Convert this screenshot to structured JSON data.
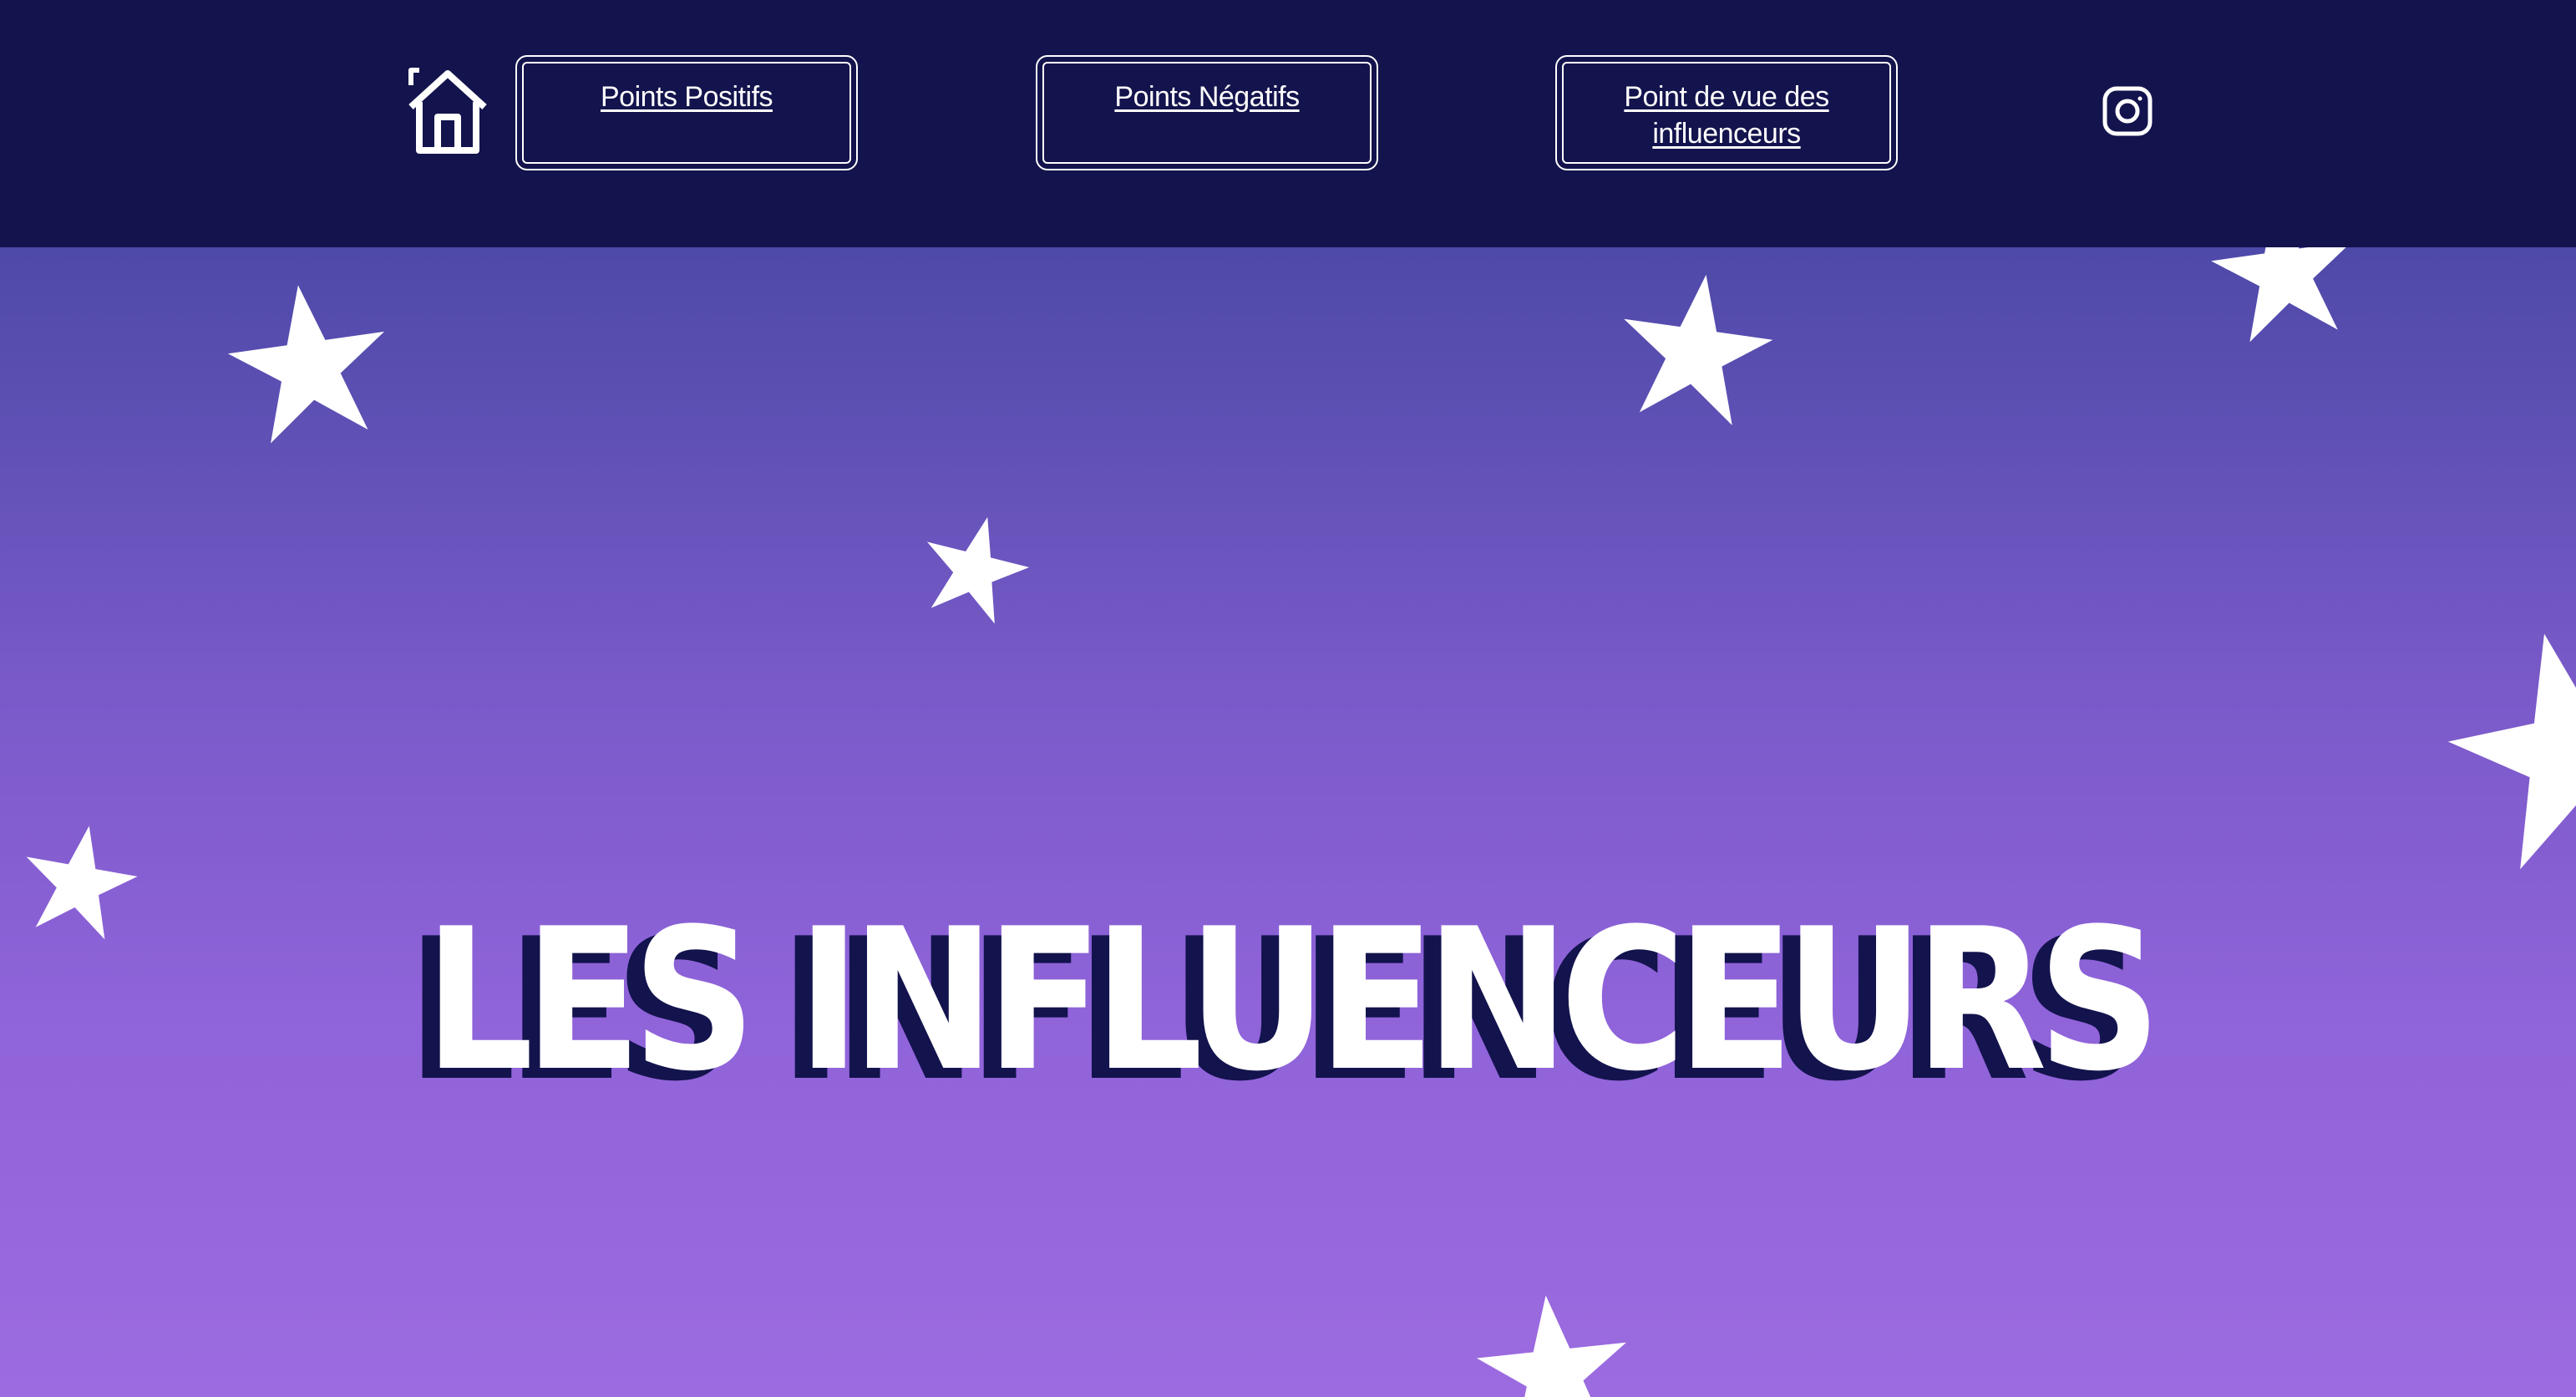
{
  "navbar": {
    "home_icon": "house-icon",
    "items": [
      {
        "label": "Points Positifs"
      },
      {
        "label": "Points Négatifs"
      },
      {
        "label": "Point de vue des influenceurs"
      }
    ],
    "social_icon": "instagram-icon"
  },
  "hero": {
    "title": "LES INFLUENCEURS"
  },
  "decorations": {
    "star_icon": "star-icon",
    "star_count": 7
  },
  "colors": {
    "navbar_background": "#13134d",
    "gradient_top": "#38409a",
    "gradient_bottom": "#9c6be0",
    "title_text": "#ffffff",
    "title_shadow": "#13134d"
  }
}
